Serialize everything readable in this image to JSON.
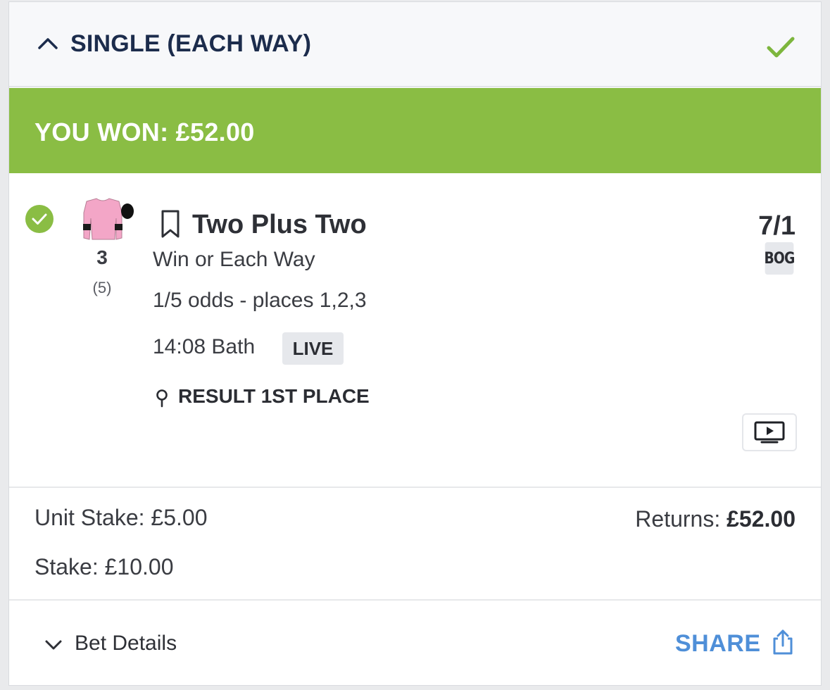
{
  "header": {
    "title": "SINGLE (EACH WAY)"
  },
  "banner": {
    "label": "YOU WON: £52.00"
  },
  "selection": {
    "runner_number": "3",
    "draw": "(5)",
    "runner_name": "Two Plus Two",
    "market": "Win or Each Way",
    "terms": "1/5 odds - places 1,2,3",
    "event": "14:08 Bath",
    "live_badge": "LIVE",
    "result": "RESULT 1ST PLACE",
    "odds": "7/1",
    "bog_badge": "BOG"
  },
  "stakes": {
    "unit_stake": "Unit Stake: £5.00",
    "stake": "Stake: £10.00",
    "returns_label": "Returns:",
    "returns_value": "£52.00"
  },
  "footer": {
    "bet_details_label": "Bet Details",
    "share_label": "SHARE"
  },
  "colors": {
    "win_banner": "#8abd44",
    "header_title": "#1c2c4c",
    "share_link": "#4f8fd8",
    "silks_pink": "#f3a6c7"
  },
  "icons": [
    "chevron-up-icon",
    "checkmark-icon",
    "check-circle-icon",
    "jockey-silks-icon",
    "bookmark-icon",
    "location-pin-icon",
    "tv-play-icon",
    "chevron-down-icon",
    "share-icon"
  ]
}
